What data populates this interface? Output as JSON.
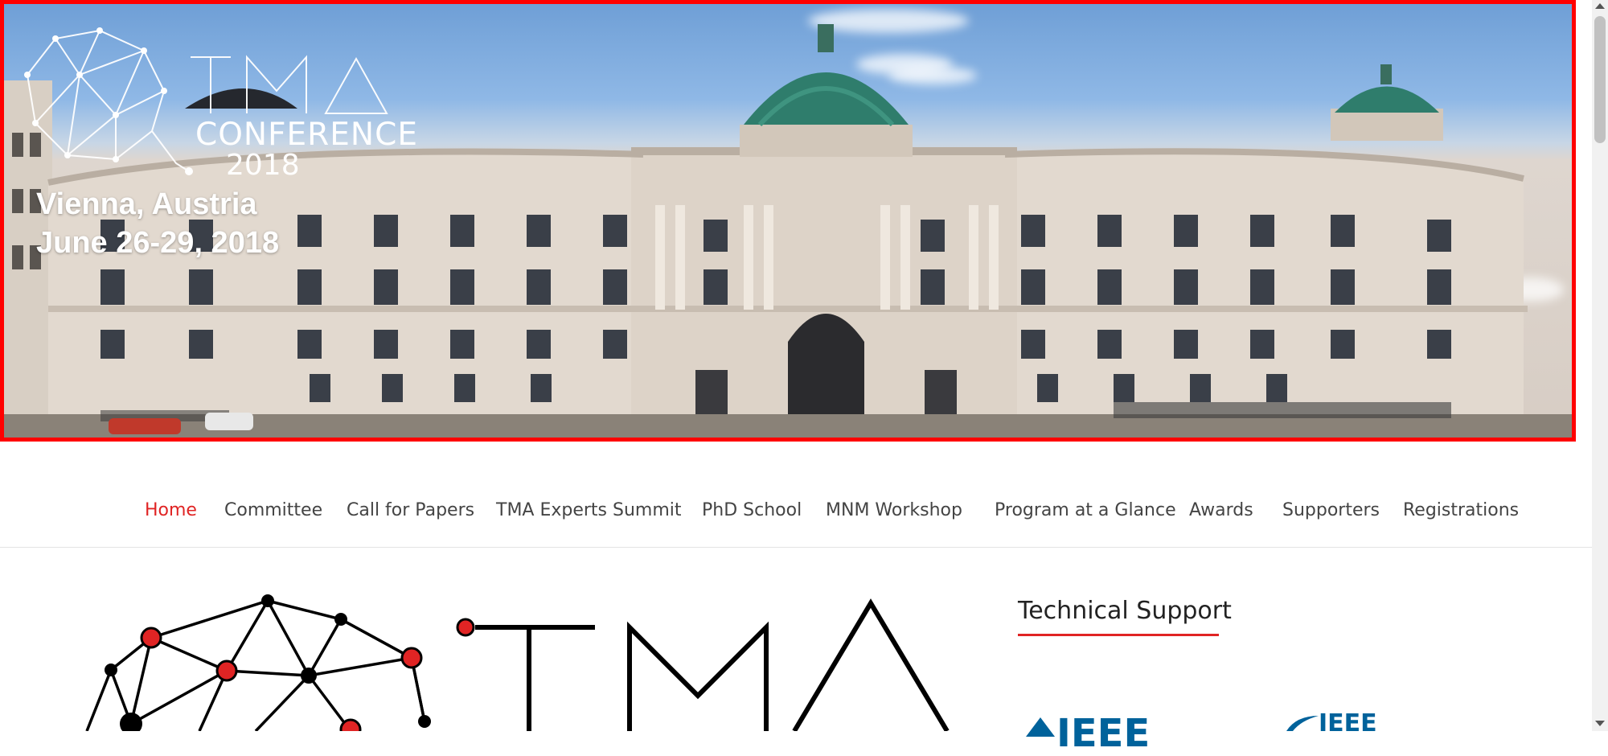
{
  "header": {
    "logo_text": "TMA",
    "conference_word": "CONFERENCE",
    "conference_year": "2018",
    "location": "Vienna, Austria",
    "dates": "June 26-29, 2018"
  },
  "nav": {
    "items": [
      {
        "label": "Home",
        "active": true
      },
      {
        "label": "Committee"
      },
      {
        "label": "Call for Papers"
      },
      {
        "label": "TMA Experts Summit"
      },
      {
        "label": "PhD School"
      },
      {
        "label": "MNM Workshop"
      },
      {
        "label": "Program at a Glance"
      },
      {
        "label": "Awards"
      },
      {
        "label": "Supporters"
      },
      {
        "label": "Registrations"
      }
    ]
  },
  "main": {
    "logo_text": "TMA"
  },
  "sidebar": {
    "title": "Technical Support",
    "logos": [
      {
        "name": "ieee-logo",
        "text": "IEEE"
      },
      {
        "name": "ieee-comsoc-logo",
        "text": "IEEE"
      }
    ]
  },
  "colors": {
    "accent": "#e02424",
    "nav_text": "#444444",
    "ieee_blue": "#00629b",
    "banner_border": "#ff0000"
  }
}
